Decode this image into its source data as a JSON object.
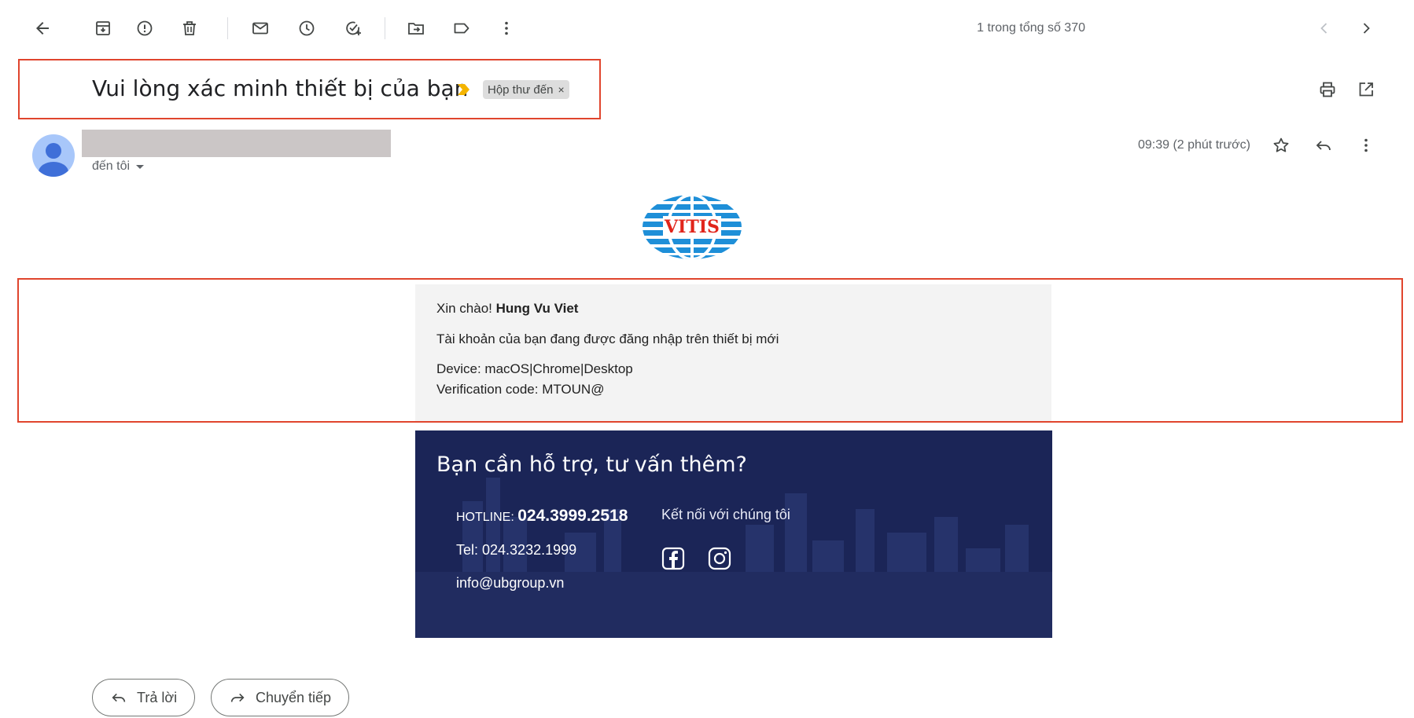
{
  "toolbar": {
    "pager_text": "1 trong tổng số 370"
  },
  "message": {
    "subject": "Vui lòng xác minh thiết bị của bạn",
    "label": "Hộp thư đến",
    "label_close": "×",
    "to_me": "đến tôi",
    "time": "09:39 (2 phút trước)"
  },
  "email_body": {
    "greeting_prefix": "Xin chào! ",
    "greeting_name": "Hung Vu Viet",
    "line2": "Tài khoản của bạn đang được đăng nhập trên thiết bị mới",
    "device": "Device: macOS|Chrome|Desktop",
    "verification": "Verification code: MTOUN@"
  },
  "logo": {
    "text": "VITIS"
  },
  "footer": {
    "title": "Bạn cần hỗ trợ, tư vấn thêm?",
    "hotline_label": "HOTLINE: ",
    "hotline_number": "024.3999.2518",
    "tel": "Tel: 024.3232.1999",
    "email": "info@ubgroup.vn",
    "connect": "Kết nối với chúng tôi"
  },
  "actions": {
    "reply": "Trả lời",
    "forward": "Chuyển tiếp"
  },
  "colors": {
    "highlight_border": "#e0452d",
    "banner_bg": "#1b2557",
    "label_chip_bg": "#dddddd",
    "importance": "#f4b400"
  }
}
